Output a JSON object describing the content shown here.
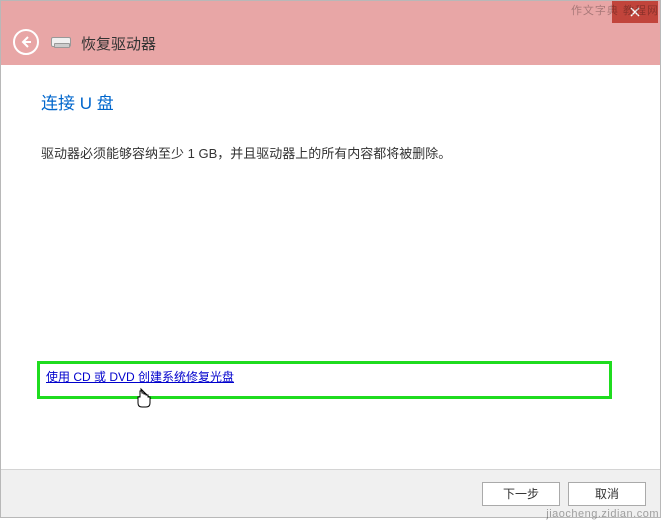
{
  "window": {
    "title": "恢复驱动器"
  },
  "content": {
    "heading": "连接 U 盘",
    "body": "驱动器必须能够容纳至少 1 GB，并且驱动器上的所有内容都将被删除。",
    "link": "使用 CD 或 DVD 创建系统修复光盘"
  },
  "footer": {
    "next": "下一步",
    "cancel": "取消"
  },
  "watermark": {
    "site": "jiaocheng.zidian.com",
    "brand": "作文字典 教程网"
  }
}
